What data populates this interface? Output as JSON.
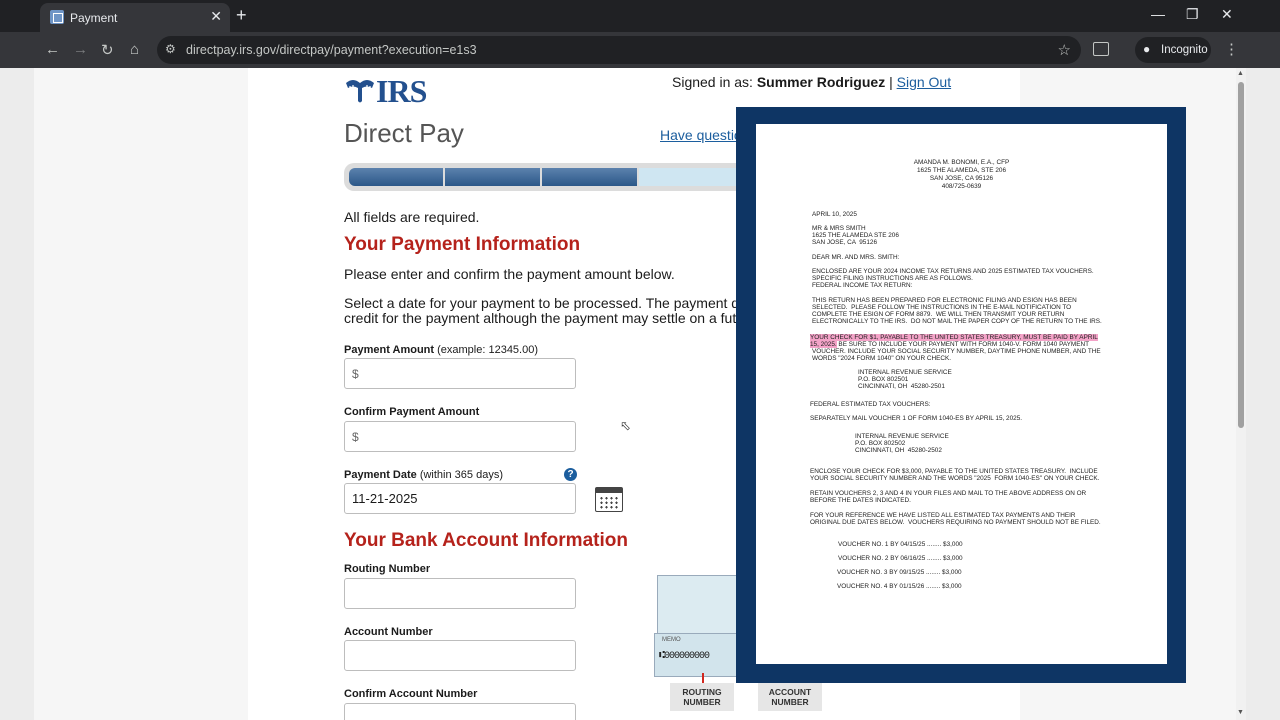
{
  "browser": {
    "tab_title": "Payment",
    "tab_close": "✕",
    "new_tab": "+",
    "url": "directpay.irs.gov/directpay/payment?execution=e1s3",
    "incognito_label": "Incognito",
    "icons": [
      "back-icon",
      "forward-icon",
      "reload-icon",
      "home-icon",
      "site-info-icon",
      "star-icon",
      "side-panel-icon",
      "incognito-icon",
      "menu-icon"
    ]
  },
  "page": {
    "logo_text": "IRS",
    "signed_in_prefix": "Signed in as:",
    "user_name": "Summer Rodriguez",
    "separator": "|",
    "sign_out": "Sign Out",
    "title": "Direct Pay",
    "questions_link": "Have questions?",
    "progress": {
      "completed_steps": 3,
      "visible_steps": 4
    },
    "required_note": "All fields are required.",
    "payment_heading": "Your Payment Information",
    "intro": "Please enter and confirm the payment amount below.",
    "date_note_line1": "Select a date for your payment to be processed. The payment date selected",
    "date_note_line2": "credit for the payment although the payment may settle on a future date.",
    "amount_label": "Payment Amount",
    "amount_hint": "(example: 12345.00)",
    "amount_prefix": "$",
    "confirm_amount_label": "Confirm Payment Amount",
    "confirm_amount_prefix": "$",
    "date_label": "Payment Date",
    "date_hint": "(within 365 days)",
    "date_value": "11-21-2025",
    "help_glyph": "?",
    "bank_heading": "Your Bank Account Information",
    "routing_label": "Routing Number",
    "account_label": "Account Number",
    "confirm_account_label": "Confirm Account Number",
    "check_memo": "MEMO",
    "check_micr": "⑆000000000",
    "routing_caption_1": "ROUTING",
    "routing_caption_2": "NUMBER",
    "account_caption_1": "ACCOUNT",
    "account_caption_2": "NUMBER"
  },
  "letter": {
    "header": [
      "AMANDA M. BONOMI, E.A., CFP",
      "1625 THE ALAMEDA, STE 206",
      "SAN JOSE, CA 95126",
      "408/725-0639"
    ],
    "date": "APRIL 10, 2025",
    "recipient": [
      "MR & MRS SMITH",
      "1625 THE ALAMEDA STE 206",
      "SAN JOSE, CA  95126"
    ],
    "salutation": "DEAR MR. AND MRS. SMITH:",
    "para1": [
      "ENCLOSED ARE YOUR 2024 INCOME TAX RETURNS AND 2025 ESTIMATED TAX VOUCHERS.",
      "SPECIFIC FILING INSTRUCTIONS ARE AS FOLLOWS.",
      "FEDERAL INCOME TAX RETURN:"
    ],
    "para2": [
      "THIS RETURN HAS BEEN PREPARED FOR ELECTRONIC FILING AND ESIGN HAS BEEN",
      "SELECTED.  PLEASE FOLLOW THE INSTRUCTIONS IN THE E-MAIL NOTIFICATION TO",
      "COMPLETE THE ESIGN OF FORM 8879.  WE WILL THEN TRANSMIT YOUR RETURN",
      "ELECTRONICALLY TO THE IRS.  DO NOT MAIL THE PAPER COPY OF THE RETURN TO THE IRS."
    ],
    "highlight1": "YOUR CHECK FOR $1, PAYABLE TO THE UNITED STATES TREASURY, MUST BE PAID BY APRIL",
    "highlight2": "15, 2025.",
    "para3_rest": " BE SURE TO INCLUDE YOUR PAYMENT WITH FORM 1040-V. FORM 1040 PAYMENT",
    "para3": [
      "VOUCHER. INCLUDE YOUR SOCIAL SECURITY NUMBER, DAYTIME PHONE NUMBER, AND THE",
      "WORDS \"2024 FORM 1040\" ON YOUR CHECK."
    ],
    "address1": [
      "INTERNAL REVENUE SERVICE",
      "P.O. BOX 802501",
      "CINCINNATI, OH  45280-2501"
    ],
    "estimated_heading": "FEDERAL ESTIMATED TAX VOUCHERS:",
    "estimated_line": "SEPARATELY MAIL VOUCHER 1 OF FORM 1040-ES BY APRIL 15, 2025.",
    "address2": [
      "INTERNAL REVENUE SERVICE",
      "P.O. BOX 802502",
      "CINCINNATI, OH  45280-2502"
    ],
    "para4": [
      "ENCLOSE YOUR CHECK FOR $3,000, PAYABLE TO THE UNITED STATES TREASURY.  INCLUDE",
      "YOUR SOCIAL SECURITY NUMBER AND THE WORDS \"2025  FORM 1040-ES\" ON YOUR CHECK."
    ],
    "para5": [
      "RETAIN VOUCHERS 2, 3 AND 4 IN YOUR FILES AND MAIL TO THE ABOVE ADDRESS ON OR",
      "BEFORE THE DATES INDICATED."
    ],
    "para6": [
      "FOR YOUR REFERENCE WE HAVE LISTED ALL ESTIMATED TAX PAYMENTS AND THEIR",
      "ORIGINAL DUE DATES BELOW.  VOUCHERS REQUIRING NO PAYMENT SHOULD NOT BE FILED."
    ],
    "vouchers": [
      "VOUCHER NO. 1 BY 04/15/25 ........ $3,000",
      "VOUCHER NO. 2 BY 06/16/25 ........ $3,000",
      "VOUCHER NO. 3 BY 09/15/25 ........ $3,000",
      "VOUCHER NO. 4 BY 01/15/26 ........ $3,000"
    ]
  },
  "colors": {
    "accent_red": "#b5221b",
    "link_blue": "#1c5e9e",
    "overlay_navy": "#0e3564"
  }
}
